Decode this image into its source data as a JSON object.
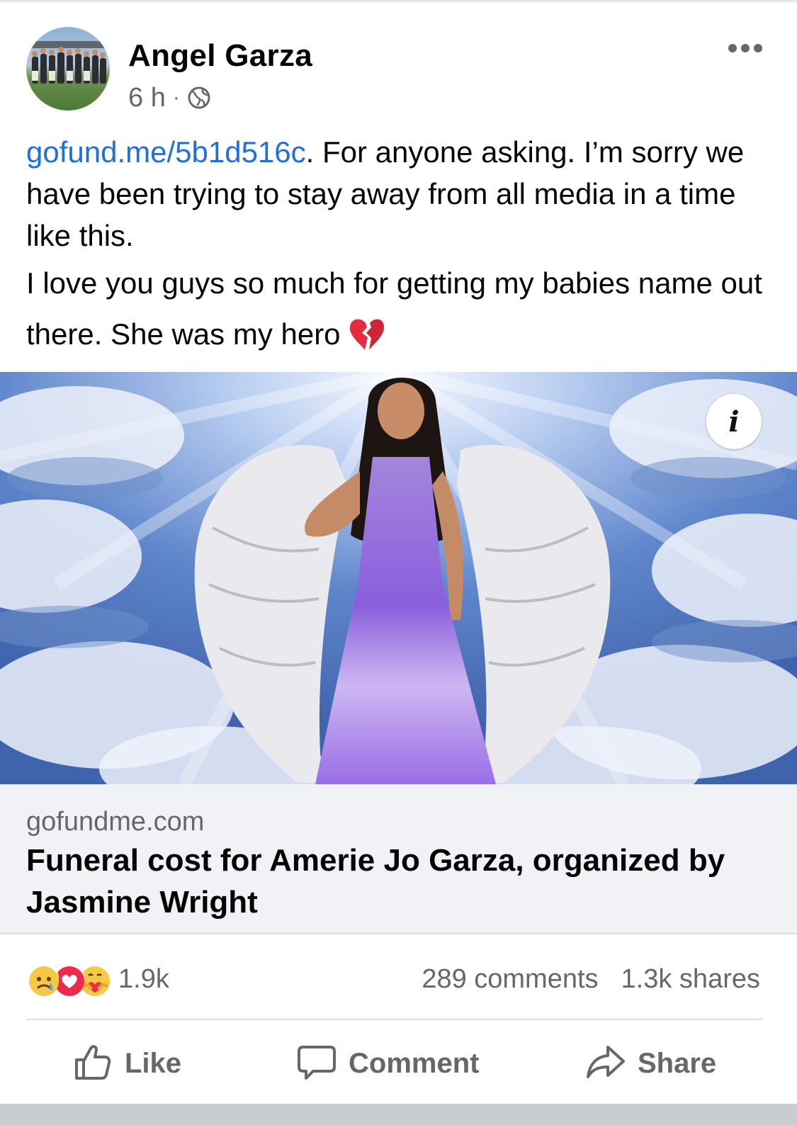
{
  "post": {
    "author": "Angel Garza",
    "timestamp": "6 h",
    "separator": "·",
    "privacy_icon": "globe-icon",
    "link_text": "gofund.me/5b1d516c",
    "text_line1": ". For anyone asking. I’m sorry we have been trying to stay away from all media in a time like this.",
    "text_line2": "I love you guys so much for getting my babies name out there. She was my hero",
    "emoji": "broken-heart-icon"
  },
  "media": {
    "info_label": "i"
  },
  "link_preview": {
    "domain": "gofundme.com",
    "title": "Funeral cost for Amerie Jo Garza, organized by Jasmine Wright"
  },
  "engagement": {
    "reactions": [
      "sad-reaction-icon",
      "love-reaction-icon",
      "care-reaction-icon"
    ],
    "reaction_count": "1.9k",
    "comments": "289 comments",
    "shares": "1.3k shares"
  },
  "actions": {
    "like": "Like",
    "comment": "Comment",
    "share": "Share"
  },
  "colors": {
    "link": "#216fdb",
    "muted": "#65676b",
    "card_bg": "#f0f2f5"
  }
}
